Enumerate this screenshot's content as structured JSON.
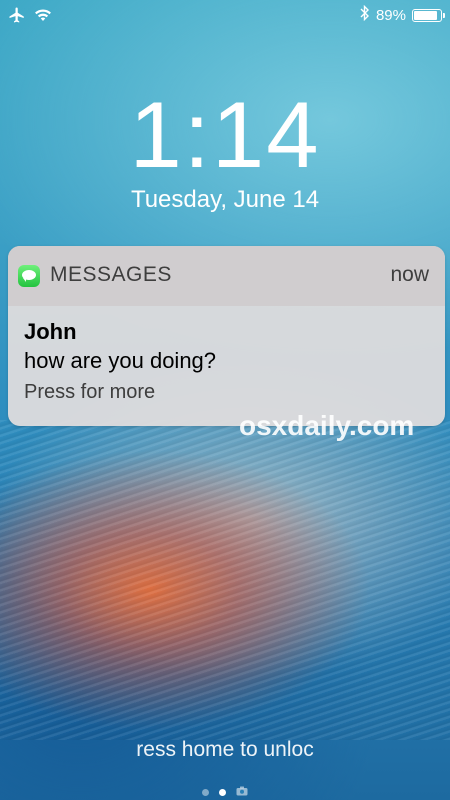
{
  "status_bar": {
    "airplane_icon": "airplane-icon",
    "wifi_icon": "wifi-icon",
    "bluetooth_icon": "bluetooth-icon",
    "battery_percent": "89%",
    "battery_level": 0.89
  },
  "lock_screen": {
    "time": "1:14",
    "date": "Tuesday, June 14",
    "unlock_hint": "ress home to unloc"
  },
  "notification": {
    "app_icon": "messages-icon",
    "app_name": "MESSAGES",
    "time": "now",
    "sender": "John",
    "message": "how are you doing?",
    "action": "Press for more"
  },
  "watermark": "osxdaily.com",
  "page_indicator": {
    "pages": 3,
    "active_index": 1,
    "camera_icon": "camera-icon"
  }
}
